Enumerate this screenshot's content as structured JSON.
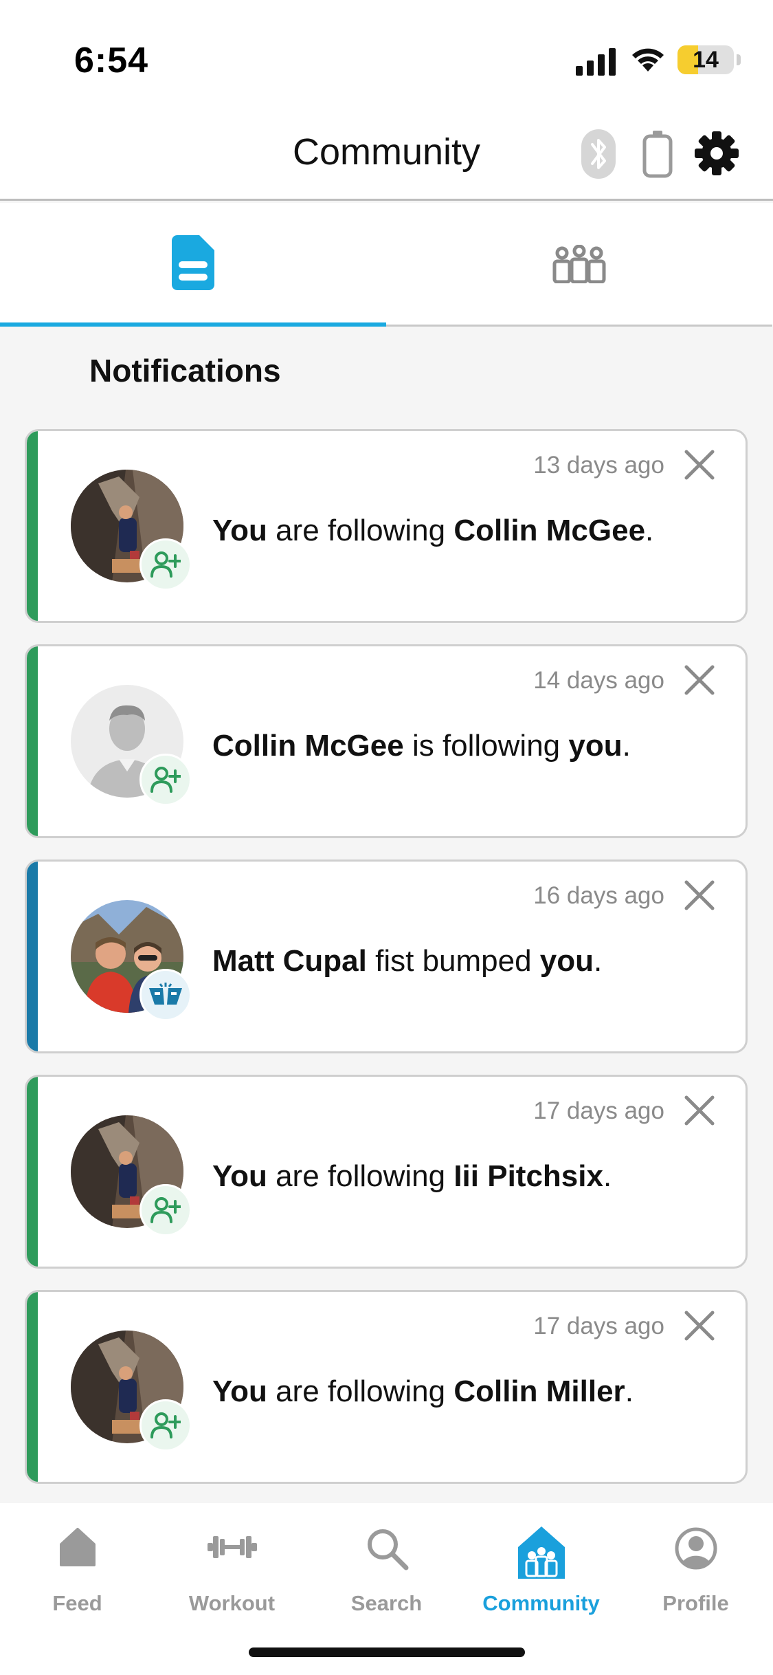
{
  "status_bar": {
    "time": "6:54",
    "battery": "14",
    "battery_level_percent": 14
  },
  "header": {
    "title": "Community"
  },
  "tabs": [
    {
      "name": "notifications",
      "icon": "document-icon",
      "active": true
    },
    {
      "name": "groups",
      "icon": "people-group-icon",
      "active": false
    }
  ],
  "section": {
    "title": "Notifications"
  },
  "notifications": [
    {
      "time": "13 days ago",
      "parts": [
        "You",
        " are following ",
        "Collin McGee",
        "."
      ],
      "type": "follow",
      "bar_color": "#2e9b5b",
      "avatar": "climber-photo"
    },
    {
      "time": "14 days ago",
      "parts": [
        "Collin McGee",
        " is following ",
        "you",
        "."
      ],
      "type": "follow",
      "bar_color": "#2e9b5b",
      "avatar": "default-person"
    },
    {
      "time": "16 days ago",
      "parts": [
        "Matt Cupal",
        " fist bumped ",
        "you",
        "."
      ],
      "type": "fist-bump",
      "bar_color": "#1a7aa8",
      "avatar": "couple-photo"
    },
    {
      "time": "17 days ago",
      "parts": [
        "You",
        " are following ",
        "Iii Pitchsix",
        "."
      ],
      "type": "follow",
      "bar_color": "#2e9b5b",
      "avatar": "climber-photo"
    },
    {
      "time": "17 days ago",
      "parts": [
        "You",
        " are following ",
        "Collin Miller",
        "."
      ],
      "type": "follow",
      "bar_color": "#2e9b5b",
      "avatar": "climber-photo"
    }
  ],
  "bottom_nav": [
    {
      "label": "Feed",
      "icon": "home-icon",
      "active": false
    },
    {
      "label": "Workout",
      "icon": "dumbbell-icon",
      "active": false
    },
    {
      "label": "Search",
      "icon": "search-icon",
      "active": false
    },
    {
      "label": "Community",
      "icon": "community-icon",
      "active": true
    },
    {
      "label": "Profile",
      "icon": "profile-icon",
      "active": false
    }
  ],
  "colors": {
    "accent": "#1aa9e0",
    "follow_green": "#2e9b5b",
    "fist_bump_blue": "#1a7aa8",
    "inactive_gray": "#9a9a9a"
  }
}
